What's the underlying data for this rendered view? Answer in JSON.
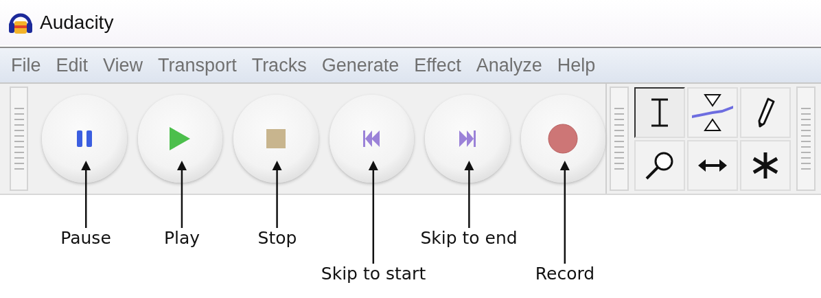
{
  "window": {
    "title": "Audacity"
  },
  "menu": [
    "File",
    "Edit",
    "View",
    "Transport",
    "Tracks",
    "Generate",
    "Effect",
    "Analyze",
    "Help"
  ],
  "transport": [
    {
      "kind": "pause",
      "callout": "Pause",
      "callout_low": false
    },
    {
      "kind": "play",
      "callout": "Play",
      "callout_low": false
    },
    {
      "kind": "stop",
      "callout": "Stop",
      "callout_low": false
    },
    {
      "kind": "skip_start",
      "callout": "Skip to start",
      "callout_low": true
    },
    {
      "kind": "skip_end",
      "callout": "Skip to end",
      "callout_low": false
    },
    {
      "kind": "record",
      "callout": "Record",
      "callout_low": true
    }
  ],
  "tools": [
    {
      "kind": "selection",
      "selected": true
    },
    {
      "kind": "envelope",
      "selected": false
    },
    {
      "kind": "draw",
      "selected": false
    },
    {
      "kind": "zoom",
      "selected": false
    },
    {
      "kind": "timeshift",
      "selected": false
    },
    {
      "kind": "multi",
      "selected": false
    }
  ]
}
